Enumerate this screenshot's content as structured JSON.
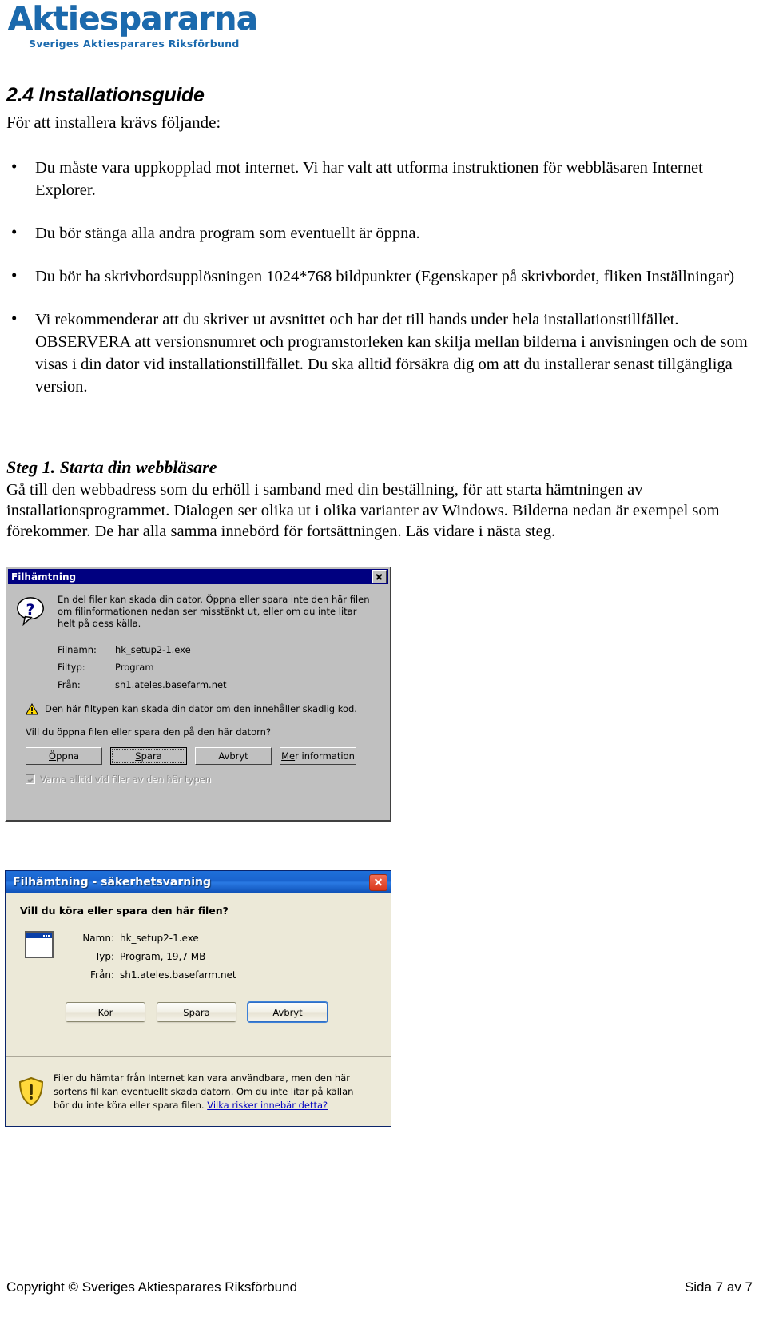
{
  "logo": {
    "word": "Aktiespararna",
    "subtitle": "Sveriges Aktiesparares Riksförbund",
    "color": "#1B6AAE"
  },
  "document": {
    "heading": "2.4 Installationsguide",
    "lead": "För att installera krävs följande:",
    "bullets": [
      "Du måste vara uppkopplad mot internet. Vi har valt att utforma instruktionen för webbläsaren Internet Explorer.",
      "Du bör stänga alla andra program som eventuellt är öppna.",
      "Du bör ha skrivbordsupplösningen 1024*768 bildpunkter (Egenskaper på skrivbordet, fliken Inställningar)",
      "Vi rekommenderar att du skriver ut avsnittet och har det till hands under hela installationstillfället. OBSERVERA att versionsnumret och programstorleken kan skilja mellan bilderna i anvisningen och de som visas i din dator vid installationstillfället. Du ska alltid försäkra dig om att du installerar senast tillgängliga version."
    ],
    "step_heading": "Steg 1. Starta din webbläsare",
    "step_body": "Gå till den webbadress som du erhöll i samband med din beställning, för att starta hämtningen av installationsprogrammet. Dialogen ser olika ut i olika varianter av Windows. Bilderna nedan är exempel som förekommer. De har alla samma innebörd för fortsättningen. Läs vidare i nästa steg."
  },
  "dialog_classic": {
    "title": "Filhämtning",
    "close_icon": "close-icon",
    "question_icon": "question-mark-icon",
    "intro": "En del filer kan skada din dator. Öppna eller spara inte den här filen om filinformationen nedan ser misstänkt ut, eller om du inte litar helt på dess källa.",
    "rows": [
      {
        "label": "Filnamn:",
        "value": "hk_setup2-1.exe"
      },
      {
        "label": "Filtyp:",
        "value": "Program"
      },
      {
        "label": "Från:",
        "value": "sh1.ateles.basefarm.net"
      }
    ],
    "warning_icon": "warning-triangle-icon",
    "warning_text": "Den här filtypen kan skada din dator om den innehåller skadlig kod.",
    "question": "Vill du öppna filen eller spara den på den här datorn?",
    "buttons": [
      {
        "mnemonic": "Ö",
        "rest": "ppna",
        "default": false
      },
      {
        "mnemonic": "S",
        "rest": "para",
        "default": true
      },
      {
        "mnemonic": "",
        "rest": "Avbryt",
        "default": false
      },
      {
        "mnemonic": "Me",
        "rest": "r information",
        "default": false
      }
    ],
    "checkbox_label": "Varna alltid vid filer av den här typen",
    "checkbox_checked": true,
    "checkbox_disabled": true,
    "titlebar_color": "#000080",
    "face_color": "#C0C0C0"
  },
  "dialog_xp": {
    "title": "Filhämtning - säkerhetsvarning",
    "close_icon": "close-icon",
    "question": "Vill du köra eller spara den här filen?",
    "file_icon": "program-window-icon",
    "rows": [
      {
        "label": "Namn:",
        "value": "hk_setup2-1.exe"
      },
      {
        "label": "Typ:",
        "value": "Program, 19,7 MB"
      },
      {
        "label": "Från:",
        "value": "sh1.ateles.basefarm.net"
      }
    ],
    "buttons": [
      {
        "label": "Kör",
        "focused": false
      },
      {
        "label": "Spara",
        "focused": false
      },
      {
        "label": "Avbryt",
        "focused": true
      }
    ],
    "shield_icon": "yellow-shield-warning-icon",
    "footer_text": "Filer du hämtar från Internet kan vara användbara, men den här sortens fil kan eventuellt skada datorn. Om du inte litar på källan bör du inte köra eller spara filen.",
    "footer_link": "Vilka risker innebär detta?",
    "titlebar_color": "#1a64cf",
    "face_color": "#ECE9D8"
  },
  "page_footer": {
    "copyright": "Copyright © Sveriges Aktiesparares Riksförbund",
    "page_number": "Sida 7 av 7"
  }
}
